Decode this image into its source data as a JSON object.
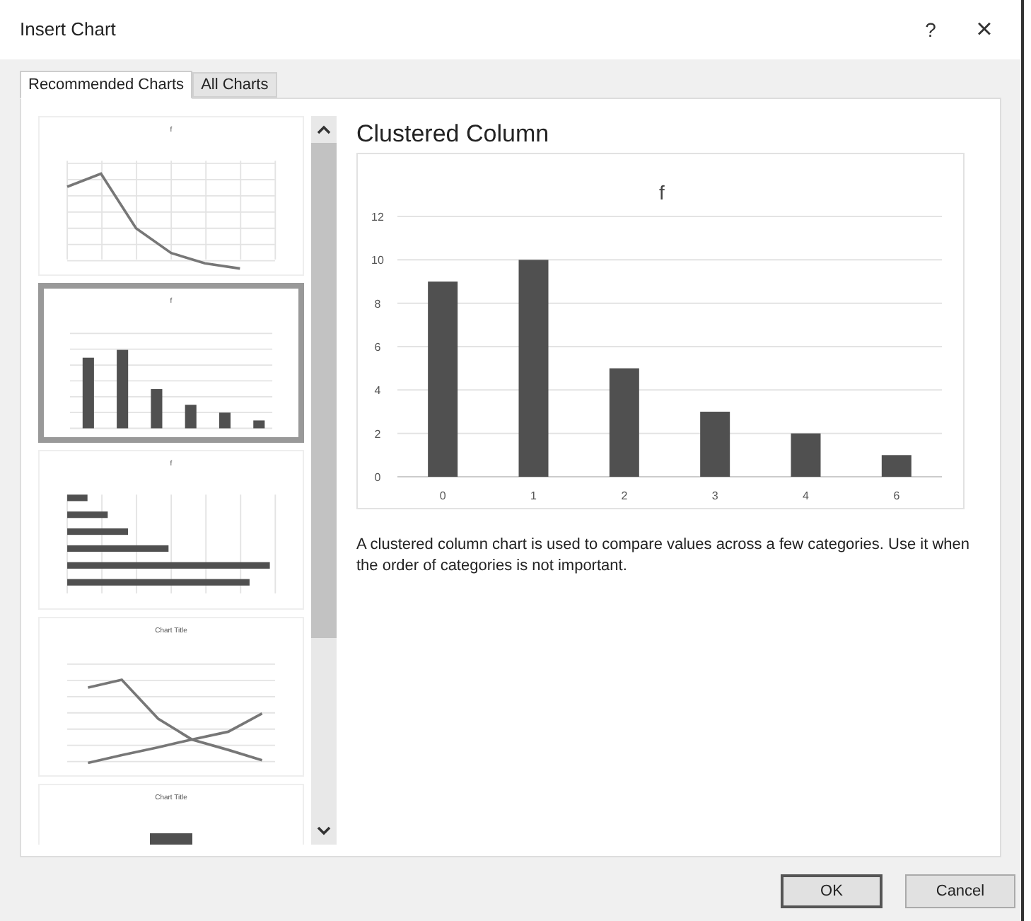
{
  "window": {
    "title": "Insert Chart",
    "help": "?",
    "close": "×"
  },
  "tabs": [
    {
      "label": "Recommended Charts",
      "selected": true
    },
    {
      "label": "All Charts",
      "selected": false
    }
  ],
  "thumbnails": [
    {
      "kind": "line",
      "title": "f",
      "selected": false
    },
    {
      "kind": "column",
      "title": "f",
      "selected": true
    },
    {
      "kind": "bar",
      "title": "f",
      "selected": false
    },
    {
      "kind": "multiline",
      "title": "Chart Title",
      "selected": false
    },
    {
      "kind": "column_single",
      "title": "Chart Title",
      "selected": false
    }
  ],
  "preview": {
    "title": "Clustered Column",
    "chart_data": {
      "type": "bar",
      "title": "f",
      "categories": [
        "0",
        "1",
        "2",
        "3",
        "4",
        "6"
      ],
      "series": [
        {
          "color": "#505050",
          "values": [
            9,
            10,
            5,
            3,
            2,
            1
          ]
        }
      ],
      "grid": true,
      "ylim": [
        0,
        12
      ],
      "yticks": [
        0,
        2,
        4,
        6,
        8,
        10,
        12
      ]
    },
    "description": "A clustered column chart is used to compare values across a few categories. Use it when the order of categories is not important."
  },
  "buttons": [
    {
      "label": "OK",
      "kind": "default"
    },
    {
      "label": "Cancel",
      "kind": "normal"
    }
  ]
}
